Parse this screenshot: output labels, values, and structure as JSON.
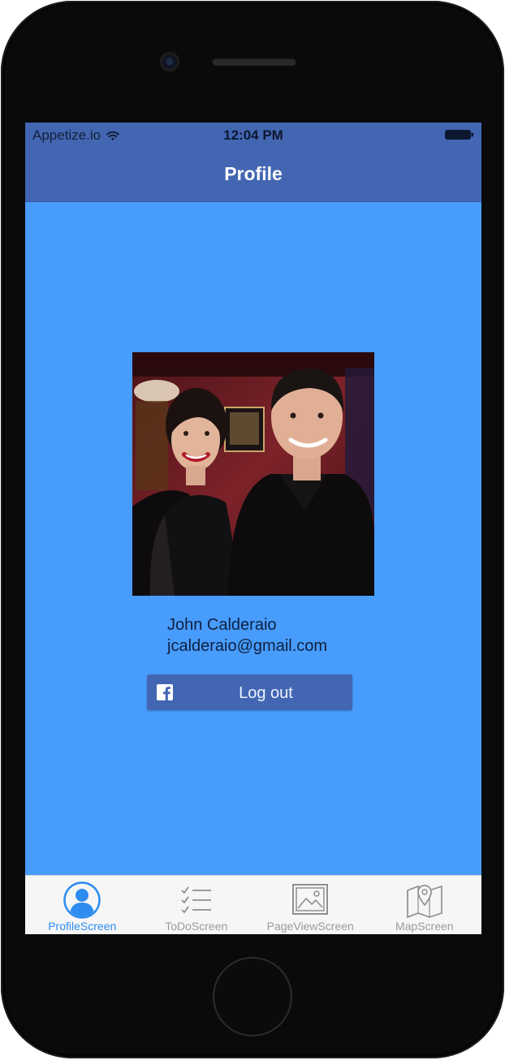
{
  "status_bar": {
    "carrier": "Appetize.io",
    "time": "12:04 PM"
  },
  "nav": {
    "title": "Profile"
  },
  "profile": {
    "name": "John Calderaio",
    "email": "jcalderaio@gmail.com",
    "logout_label": "Log out"
  },
  "tabs": [
    {
      "label": "ProfileScreen",
      "icon": "person-icon",
      "active": true
    },
    {
      "label": "ToDoScreen",
      "icon": "checklist-icon",
      "active": false
    },
    {
      "label": "PageViewScreen",
      "icon": "picture-icon",
      "active": false
    },
    {
      "label": "MapScreen",
      "icon": "map-pin-icon",
      "active": false
    }
  ],
  "colors": {
    "screen_background": "#479cfc",
    "nav_bar": "#4266b2",
    "active_tab": "#2e8cf0",
    "inactive_tab": "#9a9a9a"
  }
}
